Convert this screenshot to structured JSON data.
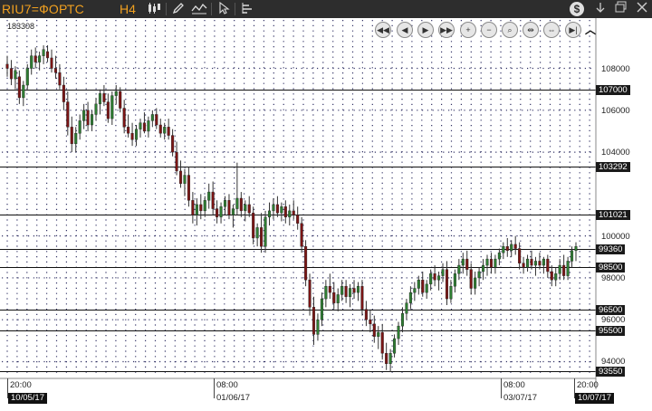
{
  "toolbar": {
    "title": "RIU7=ФОРТС",
    "timeframe": "H4",
    "icons": [
      "candles-icon",
      "pen-icon",
      "indicator-icon",
      "cursor-icon",
      "settings-bars-icon"
    ],
    "right_icons": [
      "dollar-icon",
      "download-icon",
      "restore-window-icon",
      "close-icon"
    ]
  },
  "chart": {
    "cursor_value": "183308",
    "nav_buttons": [
      "scroll-start",
      "scroll-back",
      "scroll-forward",
      "scroll-end",
      "zoom-in",
      "zoom-out",
      "zoom-fit",
      "compress",
      "expand",
      "scroll-last",
      "collapse"
    ],
    "price_ticks": [
      "108000",
      "106000",
      "104000",
      "100000",
      "98000",
      "96000",
      "94000"
    ],
    "level_lines": [
      {
        "value": "107000"
      },
      {
        "value": "103292"
      },
      {
        "value": "101021"
      },
      {
        "value": "99360"
      },
      {
        "value": "98500"
      },
      {
        "value": "96500"
      },
      {
        "value": "95500"
      },
      {
        "value": "93550"
      }
    ],
    "time_labels": [
      {
        "time": "20:00",
        "date": "10/05/17"
      },
      {
        "time": "08:00",
        "date": "01/06/17"
      },
      {
        "time": "08:00",
        "date": "03/07/17"
      },
      {
        "time": "20:00",
        "date": "10/07/17"
      }
    ],
    "colors": {
      "up": "#2e7d32",
      "down": "#7b1515",
      "wick": "#333333",
      "grid": "#333366"
    }
  },
  "chart_data": {
    "type": "candlestick",
    "y_range": [
      93200,
      110400
    ],
    "ohlc": [
      [
        108.2,
        108.6,
        107.6,
        108.0
      ],
      [
        108.0,
        108.4,
        107.2,
        107.5
      ],
      [
        107.5,
        108.1,
        107.0,
        107.9
      ],
      [
        107.6,
        107.9,
        106.3,
        106.6
      ],
      [
        106.6,
        107.4,
        106.2,
        107.2
      ],
      [
        107.2,
        108.2,
        107.0,
        108.0
      ],
      [
        108.0,
        108.9,
        107.7,
        108.6
      ],
      [
        108.6,
        109.0,
        108.0,
        108.3
      ],
      [
        108.3,
        108.8,
        107.9,
        108.6
      ],
      [
        108.6,
        109.1,
        108.2,
        108.9
      ],
      [
        108.8,
        109.1,
        108.3,
        108.5
      ],
      [
        108.5,
        108.9,
        107.8,
        108.0
      ],
      [
        108.0,
        108.6,
        107.5,
        107.8
      ],
      [
        107.8,
        108.2,
        107.0,
        107.2
      ],
      [
        107.2,
        107.6,
        106.0,
        106.4
      ],
      [
        106.4,
        106.9,
        104.8,
        105.2
      ],
      [
        105.2,
        105.7,
        104.0,
        104.4
      ],
      [
        104.4,
        105.2,
        104.0,
        104.9
      ],
      [
        104.9,
        105.8,
        104.6,
        105.5
      ],
      [
        105.5,
        106.3,
        105.1,
        106.0
      ],
      [
        106.0,
        106.4,
        105.0,
        105.3
      ],
      [
        105.3,
        106.0,
        105.0,
        105.8
      ],
      [
        105.8,
        106.6,
        105.5,
        106.3
      ],
      [
        106.3,
        107.0,
        105.8,
        106.8
      ],
      [
        106.8,
        107.2,
        106.2,
        106.4
      ],
      [
        106.4,
        106.8,
        105.4,
        105.6
      ],
      [
        105.6,
        106.9,
        105.3,
        106.7
      ],
      [
        106.7,
        107.2,
        106.3,
        106.9
      ],
      [
        106.9,
        107.1,
        105.9,
        106.1
      ],
      [
        106.1,
        106.5,
        104.9,
        105.2
      ],
      [
        105.2,
        105.8,
        104.7,
        104.9
      ],
      [
        104.9,
        105.4,
        104.3,
        104.6
      ],
      [
        104.6,
        105.3,
        104.3,
        105.1
      ],
      [
        105.1,
        105.6,
        104.7,
        105.4
      ],
      [
        105.4,
        105.9,
        104.9,
        105.0
      ],
      [
        105.0,
        105.7,
        104.7,
        105.5
      ],
      [
        105.5,
        106.0,
        105.2,
        105.8
      ],
      [
        105.8,
        106.1,
        105.1,
        105.3
      ],
      [
        105.3,
        105.6,
        104.7,
        104.9
      ],
      [
        104.9,
        105.4,
        104.6,
        105.2
      ],
      [
        105.2,
        105.6,
        104.6,
        104.8
      ],
      [
        104.8,
        105.1,
        103.8,
        104.0
      ],
      [
        104.0,
        104.5,
        102.9,
        103.1
      ],
      [
        103.1,
        103.6,
        102.3,
        102.5
      ],
      [
        102.5,
        103.2,
        101.9,
        102.9
      ],
      [
        102.9,
        103.3,
        101.4,
        101.7
      ],
      [
        101.7,
        102.1,
        100.6,
        101.0
      ],
      [
        101.0,
        101.8,
        100.5,
        101.5
      ],
      [
        101.5,
        102.0,
        100.8,
        101.2
      ],
      [
        101.2,
        101.9,
        100.9,
        101.7
      ],
      [
        101.7,
        102.5,
        101.3,
        102.1
      ],
      [
        102.1,
        102.6,
        101.0,
        101.3
      ],
      [
        101.3,
        101.7,
        100.6,
        100.9
      ],
      [
        100.9,
        101.6,
        100.6,
        101.4
      ],
      [
        101.4,
        101.9,
        101.0,
        101.7
      ],
      [
        101.7,
        102.0,
        100.8,
        101.0
      ],
      [
        101.0,
        101.5,
        100.4,
        101.3
      ],
      [
        101.3,
        103.5,
        101.0,
        101.8
      ],
      [
        101.8,
        102.1,
        100.9,
        101.2
      ],
      [
        101.2,
        101.7,
        100.7,
        101.5
      ],
      [
        101.5,
        101.9,
        100.9,
        101.1
      ],
      [
        101.1,
        101.4,
        99.6,
        99.9
      ],
      [
        99.9,
        100.6,
        99.5,
        100.4
      ],
      [
        100.4,
        101.1,
        99.2,
        99.5
      ],
      [
        99.5,
        101.2,
        99.2,
        100.9
      ],
      [
        100.9,
        101.6,
        100.5,
        101.2
      ],
      [
        101.2,
        101.8,
        100.8,
        101.5
      ],
      [
        101.5,
        101.9,
        100.9,
        101.1
      ],
      [
        101.1,
        101.6,
        100.7,
        101.4
      ],
      [
        101.4,
        101.7,
        100.6,
        100.9
      ],
      [
        100.9,
        101.5,
        100.5,
        101.2
      ],
      [
        101.2,
        101.7,
        100.8,
        101.0
      ],
      [
        101.0,
        101.4,
        100.3,
        100.6
      ],
      [
        100.6,
        100.9,
        99.2,
        99.5
      ],
      [
        99.5,
        99.8,
        97.6,
        97.9
      ],
      [
        97.9,
        98.2,
        96.2,
        96.6
      ],
      [
        96.6,
        97.1,
        94.8,
        95.3
      ],
      [
        95.3,
        96.3,
        95.0,
        96.0
      ],
      [
        96.0,
        97.3,
        95.7,
        97.0
      ],
      [
        97.0,
        97.9,
        96.6,
        97.6
      ],
      [
        97.6,
        98.2,
        97.0,
        97.3
      ],
      [
        97.3,
        97.8,
        96.5,
        96.8
      ],
      [
        96.8,
        97.5,
        96.4,
        97.2
      ],
      [
        97.2,
        97.9,
        96.9,
        97.6
      ],
      [
        97.6,
        97.9,
        96.8,
        97.1
      ],
      [
        97.1,
        97.7,
        96.6,
        97.5
      ],
      [
        97.5,
        97.9,
        97.0,
        97.3
      ],
      [
        97.3,
        97.8,
        96.9,
        97.6
      ],
      [
        97.6,
        97.9,
        96.2,
        96.5
      ],
      [
        96.5,
        96.9,
        95.7,
        96.0
      ],
      [
        96.0,
        96.5,
        95.4,
        95.8
      ],
      [
        95.8,
        96.2,
        94.9,
        95.2
      ],
      [
        95.2,
        95.7,
        94.6,
        95.4
      ],
      [
        95.4,
        95.8,
        94.1,
        94.4
      ],
      [
        94.4,
        94.9,
        93.6,
        93.9
      ],
      [
        93.9,
        94.6,
        93.5,
        94.4
      ],
      [
        94.4,
        95.3,
        94.2,
        95.1
      ],
      [
        95.1,
        95.9,
        94.8,
        95.7
      ],
      [
        95.7,
        96.6,
        95.4,
        96.3
      ],
      [
        96.3,
        97.0,
        96.0,
        96.8
      ],
      [
        96.8,
        97.6,
        96.5,
        97.3
      ],
      [
        97.3,
        97.8,
        96.9,
        97.5
      ],
      [
        97.5,
        98.1,
        97.2,
        97.9
      ],
      [
        97.9,
        98.3,
        97.1,
        97.3
      ],
      [
        97.3,
        97.9,
        97.0,
        97.7
      ],
      [
        97.7,
        98.4,
        97.4,
        98.2
      ],
      [
        98.2,
        98.6,
        97.6,
        97.9
      ],
      [
        97.9,
        98.3,
        97.4,
        98.1
      ],
      [
        98.1,
        98.7,
        97.8,
        98.4
      ],
      [
        98.4,
        98.8,
        96.7,
        97.0
      ],
      [
        97.0,
        97.9,
        96.8,
        97.6
      ],
      [
        97.6,
        98.4,
        97.3,
        98.2
      ],
      [
        98.2,
        98.9,
        97.9,
        98.6
      ],
      [
        98.6,
        99.2,
        98.2,
        98.9
      ],
      [
        98.9,
        99.3,
        98.1,
        98.4
      ],
      [
        98.4,
        98.7,
        97.2,
        97.5
      ],
      [
        97.5,
        98.3,
        97.2,
        98.0
      ],
      [
        98.0,
        98.5,
        97.6,
        98.3
      ],
      [
        98.3,
        98.9,
        97.9,
        98.6
      ],
      [
        98.6,
        99.1,
        98.1,
        98.9
      ],
      [
        98.9,
        99.2,
        98.2,
        98.5
      ],
      [
        98.5,
        99.1,
        98.2,
        98.9
      ],
      [
        98.9,
        99.4,
        98.6,
        99.2
      ],
      [
        99.2,
        99.7,
        98.9,
        99.5
      ],
      [
        99.5,
        99.9,
        99.0,
        99.3
      ],
      [
        99.3,
        99.8,
        99.0,
        99.6
      ],
      [
        99.6,
        100.0,
        99.1,
        99.4
      ],
      [
        99.4,
        99.7,
        98.4,
        98.7
      ],
      [
        98.7,
        99.0,
        98.2,
        98.5
      ],
      [
        98.5,
        99.1,
        98.3,
        98.9
      ],
      [
        98.9,
        99.3,
        98.4,
        98.6
      ],
      [
        98.6,
        99.0,
        98.1,
        98.8
      ],
      [
        98.8,
        99.2,
        98.4,
        98.6
      ],
      [
        98.6,
        99.0,
        98.2,
        98.9
      ],
      [
        98.9,
        99.1,
        98.0,
        98.3
      ],
      [
        98.3,
        98.6,
        97.6,
        97.9
      ],
      [
        97.9,
        98.5,
        97.6,
        98.2
      ],
      [
        98.2,
        98.9,
        97.9,
        98.6
      ],
      [
        98.6,
        99.1,
        97.9,
        98.1
      ],
      [
        98.1,
        99.0,
        97.9,
        98.8
      ],
      [
        98.8,
        99.5,
        98.5,
        99.3
      ],
      [
        99.3,
        99.7,
        98.8,
        99.5
      ]
    ]
  }
}
